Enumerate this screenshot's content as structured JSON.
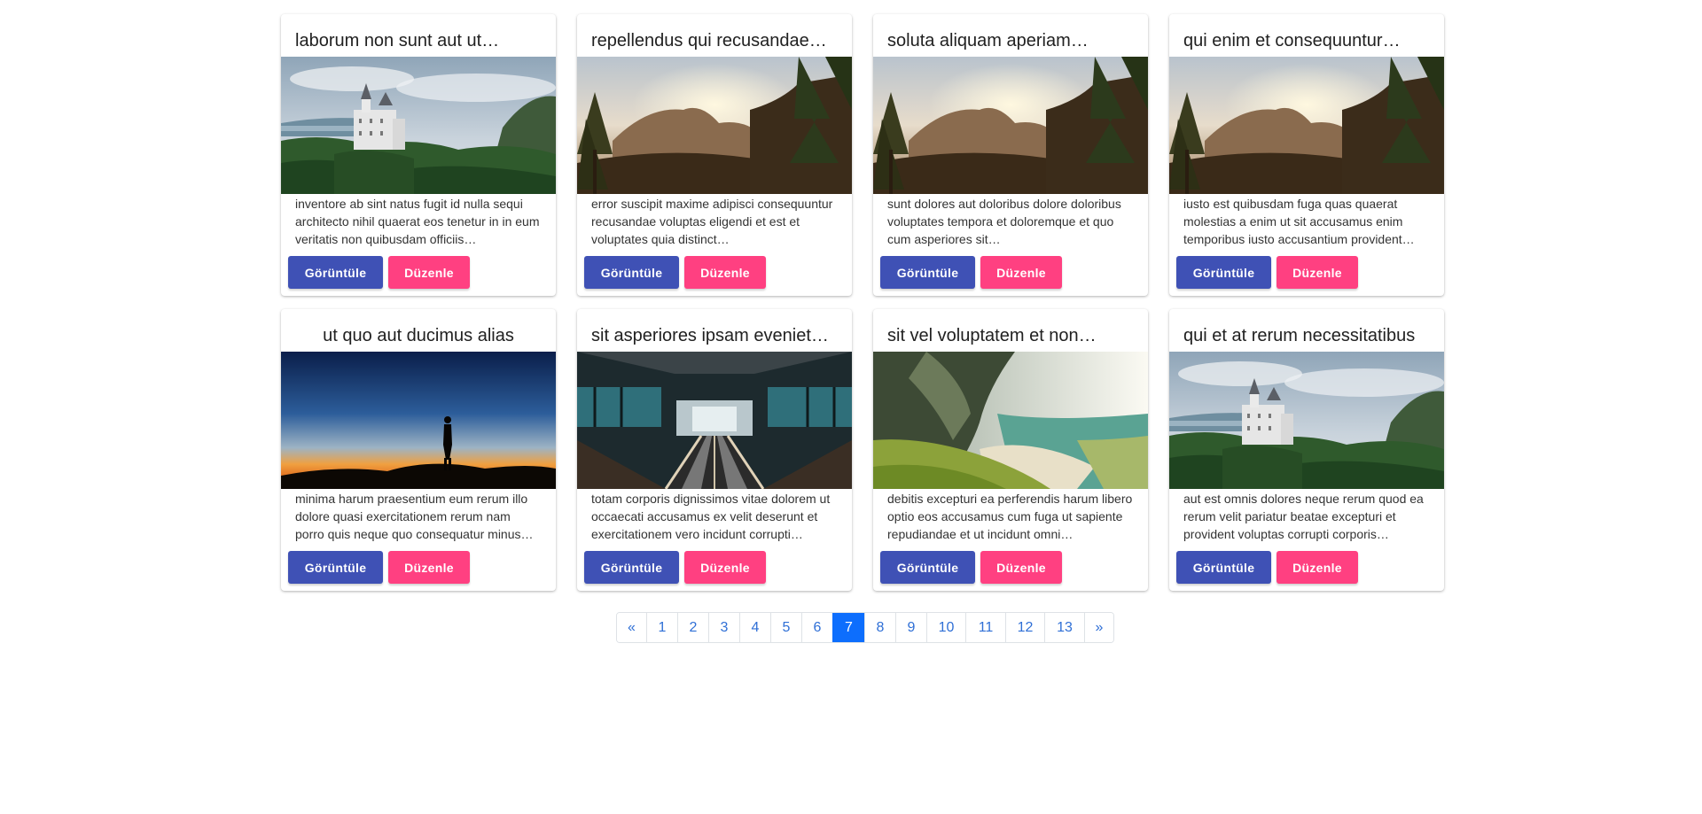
{
  "colors": {
    "view_button": "#3f51b5",
    "edit_button": "#ff4081",
    "page_link": "#2f6fd6",
    "page_active": "#0d6efd"
  },
  "buttons": {
    "view_label": "Görüntüle",
    "edit_label": "Düzenle"
  },
  "cards": [
    {
      "title": "laborum non sunt aut ut…",
      "image": "castle",
      "text": "inventore ab sint natus fugit id nulla sequi architecto nihil quaerat eos tenetur in in eum veritatis non quibusdam officiis…"
    },
    {
      "title": "repellendus qui recusandae…",
      "image": "sunset-forest",
      "text": "error suscipit maxime adipisci consequuntur recusandae voluptas eligendi et est et voluptates quia distinct…"
    },
    {
      "title": "soluta aliquam aperiam…",
      "image": "sunset-forest",
      "text": "sunt dolores aut doloribus dolore doloribus voluptates tempora et doloremque et quo cum asperiores sit…"
    },
    {
      "title": "qui enim et consequuntur…",
      "image": "sunset-forest",
      "text": "iusto est quibusdam fuga quas quaerat molestias a enim ut sit accusamus enim temporibus iusto accusantium provident…"
    },
    {
      "title": "ut quo aut ducimus alias",
      "image": "silhouette-dusk",
      "text": "minima harum praesentium eum rerum illo dolore quasi exercitationem rerum nam porro quis neque quo consequatur minus…"
    },
    {
      "title": "sit asperiores ipsam eveniet…",
      "image": "escalator",
      "text": "totam corporis dignissimos vitae dolorem ut occaecati accusamus ex velit deserunt et exercitationem vero incidunt corrupti…"
    },
    {
      "title": "sit vel voluptatem et non…",
      "image": "coast-cliffs",
      "text": "debitis excepturi ea perferendis harum libero optio eos accusamus cum fuga ut sapiente repudiandae et ut incidunt omni…"
    },
    {
      "title": "qui et at rerum necessitatibus",
      "image": "castle",
      "text": "aut est omnis dolores neque rerum quod ea rerum velit pariatur beatae excepturi et provident voluptas corrupti corporis…"
    }
  ],
  "pagination": {
    "prev": "«",
    "next": "»",
    "pages": [
      "1",
      "2",
      "3",
      "4",
      "5",
      "6",
      "7",
      "8",
      "9",
      "10",
      "11",
      "12",
      "13"
    ],
    "active": "7"
  }
}
